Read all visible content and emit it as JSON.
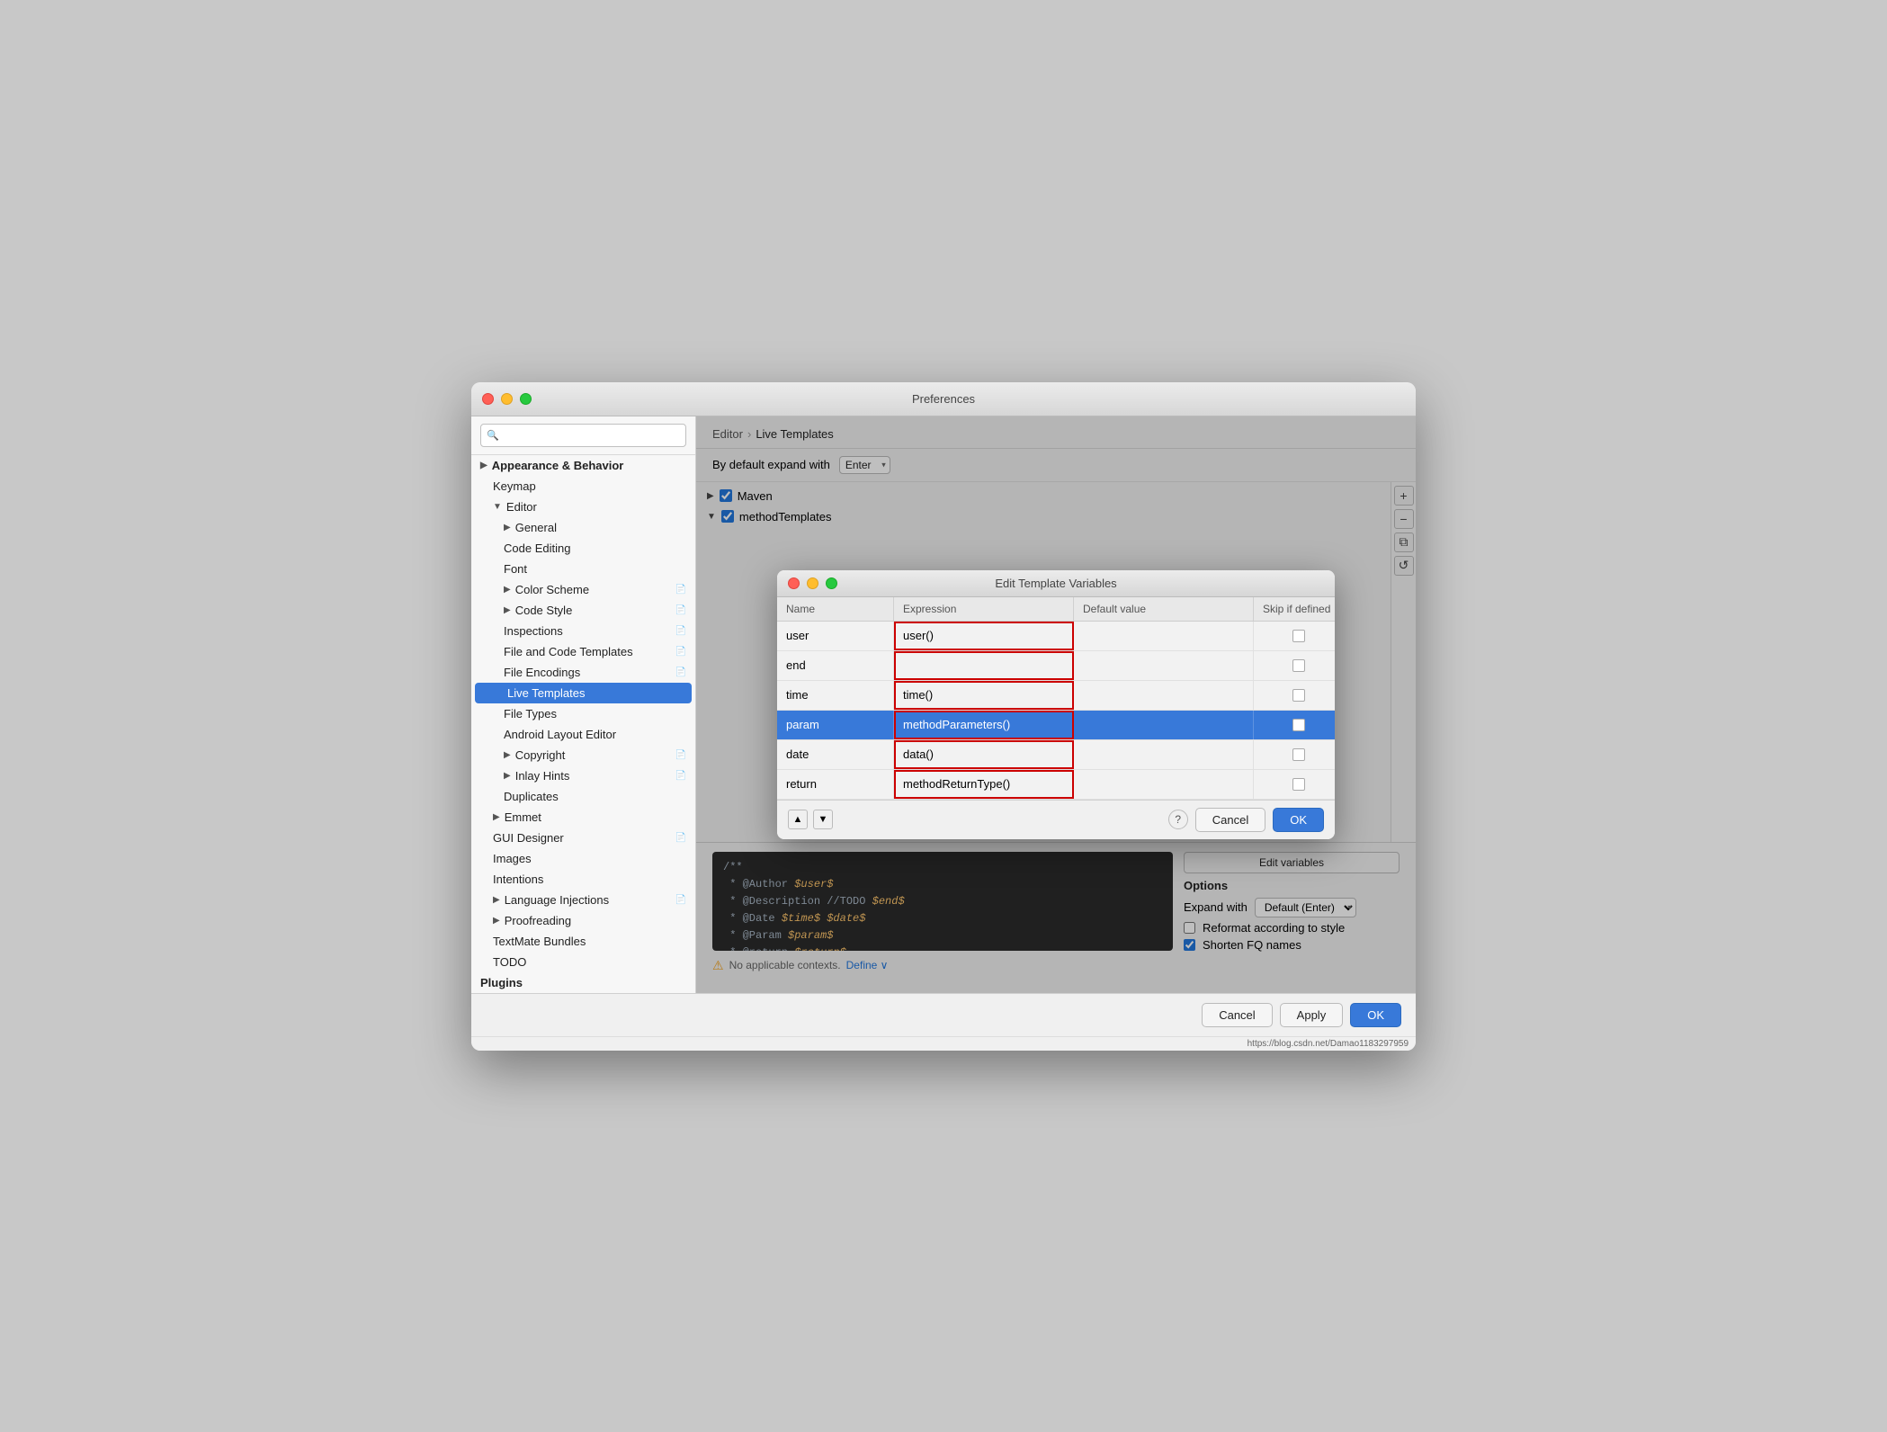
{
  "window": {
    "title": "Preferences",
    "url": "https://blog.csdn.net/Damao1183297959"
  },
  "sidebar": {
    "search_placeholder": "🔍",
    "items": [
      {
        "id": "appearance-behavior",
        "label": "Appearance & Behavior",
        "level": "parent",
        "expanded": true,
        "arrow": "▶"
      },
      {
        "id": "keymap",
        "label": "Keymap",
        "level": "child"
      },
      {
        "id": "editor",
        "label": "Editor",
        "level": "child",
        "expanded": true,
        "arrow": "▼"
      },
      {
        "id": "general",
        "label": "General",
        "level": "child2",
        "arrow": "▶"
      },
      {
        "id": "code-editing",
        "label": "Code Editing",
        "level": "child2"
      },
      {
        "id": "font",
        "label": "Font",
        "level": "child2"
      },
      {
        "id": "color-scheme",
        "label": "Color Scheme",
        "level": "child2",
        "arrow": "▶",
        "badge": "📄"
      },
      {
        "id": "code-style",
        "label": "Code Style",
        "level": "child2",
        "arrow": "▶",
        "badge": "📄"
      },
      {
        "id": "inspections",
        "label": "Inspections",
        "level": "child2",
        "badge": "📄"
      },
      {
        "id": "file-code-templates",
        "label": "File and Code Templates",
        "level": "child2",
        "badge": "📄"
      },
      {
        "id": "file-encodings",
        "label": "File Encodings",
        "level": "child2",
        "badge": "📄"
      },
      {
        "id": "live-templates",
        "label": "Live Templates",
        "level": "child2",
        "active": true
      },
      {
        "id": "file-types",
        "label": "File Types",
        "level": "child2"
      },
      {
        "id": "android-layout-editor",
        "label": "Android Layout Editor",
        "level": "child2"
      },
      {
        "id": "copyright",
        "label": "Copyright",
        "level": "child2",
        "arrow": "▶",
        "badge": "📄"
      },
      {
        "id": "inlay-hints",
        "label": "Inlay Hints",
        "level": "child2",
        "arrow": "▶",
        "badge": "📄"
      },
      {
        "id": "duplicates",
        "label": "Duplicates",
        "level": "child2"
      },
      {
        "id": "emmet",
        "label": "Emmet",
        "level": "child",
        "arrow": "▶"
      },
      {
        "id": "gui-designer",
        "label": "GUI Designer",
        "level": "child",
        "badge": "📄"
      },
      {
        "id": "images",
        "label": "Images",
        "level": "child"
      },
      {
        "id": "intentions",
        "label": "Intentions",
        "level": "child"
      },
      {
        "id": "language-injections",
        "label": "Language Injections",
        "level": "child",
        "arrow": "▶",
        "badge": "📄"
      },
      {
        "id": "proofreading",
        "label": "Proofreading",
        "level": "child",
        "arrow": "▶"
      },
      {
        "id": "textmate-bundles",
        "label": "TextMate Bundles",
        "level": "child"
      },
      {
        "id": "todo",
        "label": "TODO",
        "level": "child"
      },
      {
        "id": "plugins",
        "label": "Plugins",
        "level": "parent"
      }
    ]
  },
  "main": {
    "breadcrumb": {
      "parent": "Editor",
      "separator": "›",
      "current": "Live Templates"
    },
    "expand_label": "By default expand with",
    "expand_option": "Enter",
    "template_groups": [
      {
        "id": "maven",
        "label": "Maven",
        "expanded": false,
        "checked": true,
        "arrow": "▶"
      },
      {
        "id": "method-templates",
        "label": "methodTemplates",
        "expanded": true,
        "checked": true,
        "arrow": "▼"
      }
    ],
    "list_buttons": [
      "+",
      "−",
      "⧉",
      "↺"
    ],
    "code_preview": [
      "/**",
      " * @Author $user$",
      " * @Description //TODO $end$",
      " * @Date $time$ $date$",
      " * @Param $param$",
      " * @return $return$"
    ],
    "no_context_label": "No applicable contexts.",
    "define_label": "Define ∨",
    "options": {
      "label": "Options",
      "expand_with_label": "Expand with",
      "expand_with_value": "Default (Enter)",
      "reformat_label": "Reformat according to style",
      "reformat_checked": false,
      "shorten_fq_label": "Shorten FQ names",
      "shorten_fq_checked": true
    },
    "edit_variables_btn": "Edit variables"
  },
  "modal": {
    "title": "Edit Template Variables",
    "columns": [
      "Name",
      "Expression",
      "Default value",
      "Skip if defined"
    ],
    "rows": [
      {
        "name": "user",
        "expression": "user()",
        "default_value": "",
        "skip": false,
        "selected": false
      },
      {
        "name": "end",
        "expression": "",
        "default_value": "",
        "skip": false,
        "selected": false
      },
      {
        "name": "time",
        "expression": "time()",
        "default_value": "",
        "skip": false,
        "selected": false
      },
      {
        "name": "param",
        "expression": "methodParameters()",
        "default_value": "",
        "skip": true,
        "selected": true
      },
      {
        "name": "date",
        "expression": "data()",
        "default_value": "",
        "skip": false,
        "selected": false
      },
      {
        "name": "return",
        "expression": "methodReturnType()",
        "default_value": "",
        "skip": false,
        "selected": false
      }
    ],
    "cancel_btn": "Cancel",
    "ok_btn": "OK"
  },
  "bottom_bar": {
    "cancel_label": "Cancel",
    "apply_label": "Apply",
    "ok_label": "OK"
  }
}
